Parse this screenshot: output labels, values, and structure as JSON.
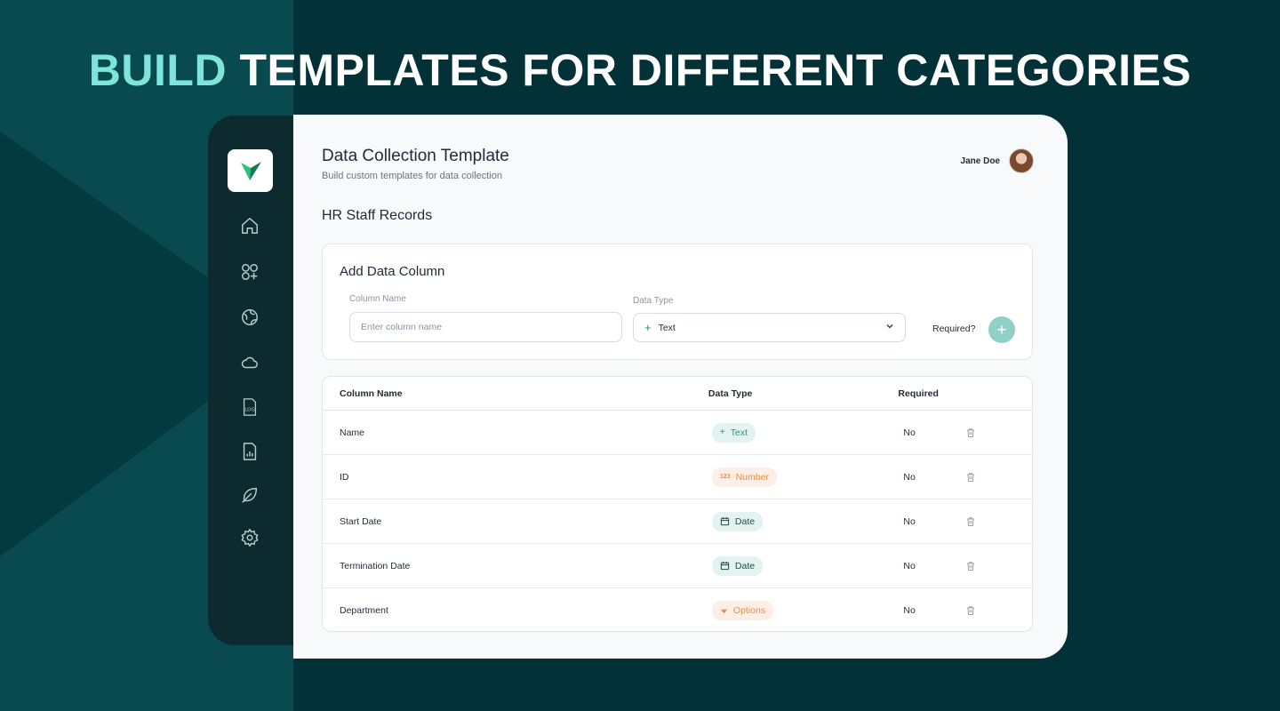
{
  "headline": {
    "accent": "BUILD",
    "rest": "TEMPLATES FOR DIFFERENT CATEGORIES"
  },
  "colors": {
    "background": "#023238",
    "accent": "#7ee4dc",
    "sidebar": "#0d2b2f",
    "add_button": "#8fd1c9",
    "teal_badge": "#2e8e86",
    "orange_badge": "#ee8a47"
  },
  "sidebar": {
    "logo": "checkmark-logo",
    "items": [
      {
        "icon": "home-icon"
      },
      {
        "icon": "apps-add-icon"
      },
      {
        "icon": "globe-icon"
      },
      {
        "icon": "cloud-icon"
      },
      {
        "icon": "log-file-icon"
      },
      {
        "icon": "report-icon"
      },
      {
        "icon": "leaf-icon"
      },
      {
        "icon": "gear-icon"
      }
    ]
  },
  "header": {
    "title": "Data Collection Template",
    "subtitle": "Build custom templates for data collection",
    "user_name": "Jane Doe"
  },
  "section_title": "HR Staff Records",
  "add_column": {
    "title": "Add Data Column",
    "column_name_label": "Column Name",
    "column_name_placeholder": "Enter column name",
    "column_name_value": "",
    "data_type_label": "Data Type",
    "data_type_value": "Text",
    "required_label": "Required?",
    "add_button": "+"
  },
  "table": {
    "headers": [
      "Column Name",
      "Data Type",
      "Required"
    ],
    "rows": [
      {
        "name": "Name",
        "type": "Text",
        "type_icon": "plus-icon",
        "required": "No"
      },
      {
        "name": "ID",
        "type": "Number",
        "type_icon": "number-icon",
        "required": "No"
      },
      {
        "name": "Start Date",
        "type": "Date",
        "type_icon": "calendar-icon",
        "required": "No"
      },
      {
        "name": "Termination Date",
        "type": "Date",
        "type_icon": "calendar-icon",
        "required": "No"
      },
      {
        "name": "Department",
        "type": "Options",
        "type_icon": "caret-down-icon",
        "required": "No"
      }
    ]
  }
}
